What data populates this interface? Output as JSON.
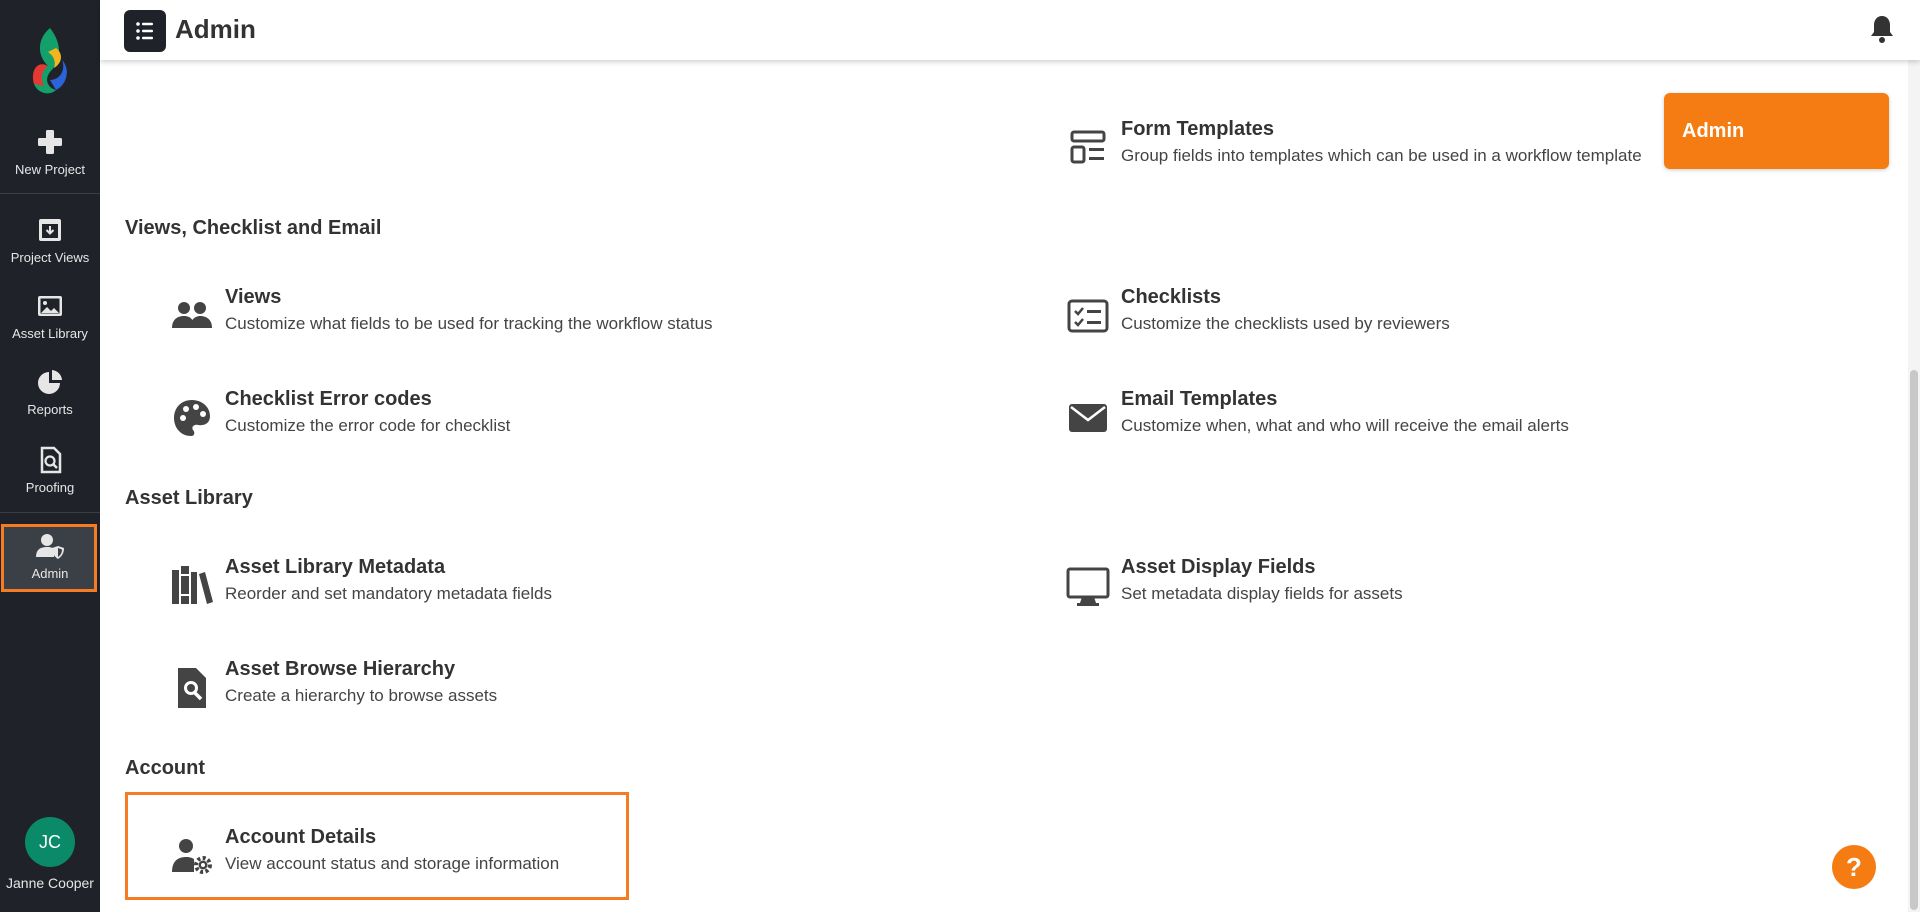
{
  "app": {
    "title": "Admin"
  },
  "sidebar": {
    "items": [
      {
        "label": "New Project",
        "icon": "plus-icon"
      },
      {
        "label": "Project Views",
        "icon": "archive-download-icon"
      },
      {
        "label": "Asset Library",
        "icon": "image-icon"
      },
      {
        "label": "Reports",
        "icon": "pie-chart-icon"
      },
      {
        "label": "Proofing",
        "icon": "proofing-search-icon"
      },
      {
        "label": "Admin",
        "icon": "user-shield-icon",
        "active": true
      }
    ],
    "user": {
      "initials": "JC",
      "name": "Janne Cooper"
    }
  },
  "main": {
    "floating_tag": "Admin",
    "sections": [
      {
        "title": "",
        "items": [
          {
            "title": "Form Templates",
            "desc": "Group fields into templates which can be used in a workflow template",
            "icon": "form-template-icon"
          }
        ]
      },
      {
        "title": "Views, Checklist and Email",
        "items": [
          {
            "title": "Views",
            "desc": "Customize what fields to be used for tracking the workflow status",
            "icon": "people-icon"
          },
          {
            "title": "Checklists",
            "desc": "Customize the checklists used by reviewers",
            "icon": "checklist-icon"
          },
          {
            "title": "Checklist Error codes",
            "desc": "Customize the error code for checklist",
            "icon": "palette-icon"
          },
          {
            "title": "Email Templates",
            "desc": "Customize when, what and who will receive the email alerts",
            "icon": "envelope-icon"
          }
        ]
      },
      {
        "title": "Asset Library",
        "items": [
          {
            "title": "Asset Library Metadata",
            "desc": "Reorder and set mandatory metadata fields",
            "icon": "books-icon"
          },
          {
            "title": "Asset Display Fields",
            "desc": "Set metadata display fields for assets",
            "icon": "monitor-icon"
          },
          {
            "title": "Asset Browse Hierarchy",
            "desc": "Create a hierarchy to browse assets",
            "icon": "file-search-icon"
          }
        ]
      },
      {
        "title": "Account",
        "items": [
          {
            "title": "Account Details",
            "desc": "View account status and storage information",
            "icon": "user-gear-icon"
          }
        ]
      }
    ]
  },
  "help": {
    "label": "?"
  },
  "colors": {
    "accent": "#f57c12",
    "sidebar_bg": "#1f2329",
    "avatar_bg": "#0b8a6a"
  }
}
